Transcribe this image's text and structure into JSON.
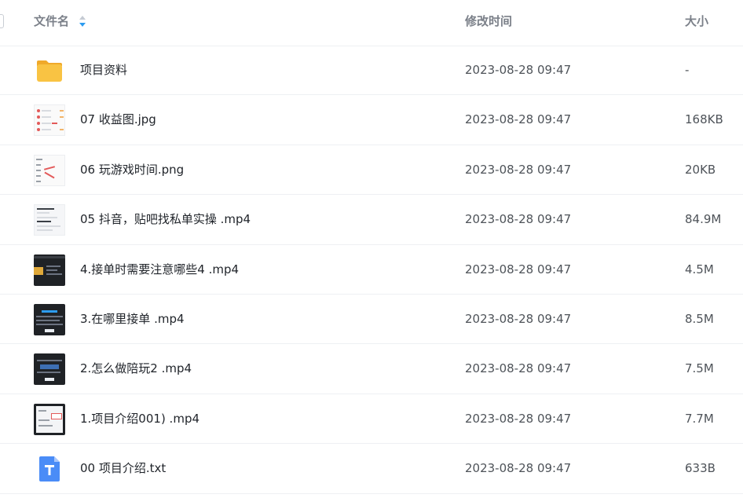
{
  "header": {
    "name_label": "文件名",
    "time_label": "修改时间",
    "size_label": "大小",
    "sort_icon": "sort-toggle-icon"
  },
  "files": [
    {
      "name": "项目资料",
      "time": "2023-08-28 09:47",
      "size": "-",
      "icon": "folder-icon"
    },
    {
      "name": "07 收益图.jpg",
      "time": "2023-08-28 09:47",
      "size": "168KB",
      "icon": "image-thumbnail"
    },
    {
      "name": "06 玩游戏时间.png",
      "time": "2023-08-28 09:47",
      "size": "20KB",
      "icon": "image-thumbnail"
    },
    {
      "name": "05 抖音，贴吧找私单实操 .mp4",
      "time": "2023-08-28 09:47",
      "size": "84.9M",
      "icon": "video-thumbnail"
    },
    {
      "name": "4.接单时需要注意哪些4 .mp4",
      "time": "2023-08-28 09:47",
      "size": "4.5M",
      "icon": "video-thumbnail"
    },
    {
      "name": "3.在哪里接单 .mp4",
      "time": "2023-08-28 09:47",
      "size": "8.5M",
      "icon": "video-thumbnail"
    },
    {
      "name": "2.怎么做陪玩2 .mp4",
      "time": "2023-08-28 09:47",
      "size": "7.5M",
      "icon": "video-thumbnail"
    },
    {
      "name": "1.项目介绍001) .mp4",
      "time": "2023-08-28 09:47",
      "size": "7.7M",
      "icon": "video-thumbnail"
    },
    {
      "name": "00 项目介绍.txt",
      "time": "2023-08-28 09:47",
      "size": "633B",
      "icon": "text-file-icon"
    }
  ],
  "colors": {
    "folder": "#f9c343",
    "text_file": "#4a8cf7",
    "accent_blue": "#2d9cf0"
  }
}
